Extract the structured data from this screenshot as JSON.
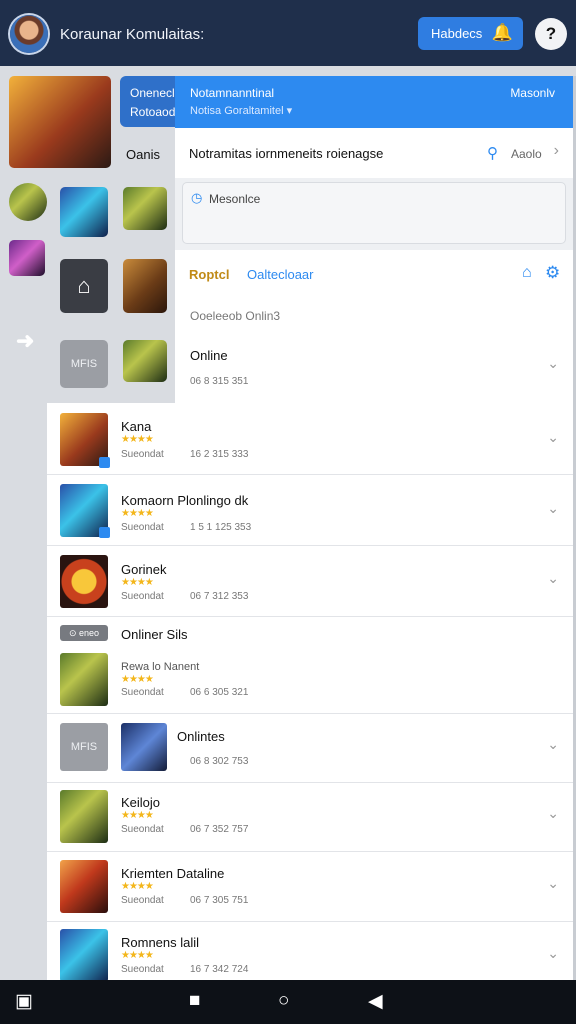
{
  "header": {
    "title": "Koraunar Komulaitas:",
    "action_button": "Habdecs",
    "help_glyph": "?"
  },
  "background": {
    "blue_chip_line1": "Onenecl",
    "blue_chip_line2": "Rotoaod",
    "side_label": "Oanis",
    "gray_tile": "MFIS"
  },
  "dropdown": {
    "header_line1": "Notamnanntinal",
    "header_line2": "Notisa Goraltamitel ▾",
    "header_right": "Masonlv",
    "search_text": "Notramitas iornmeneits roienagse",
    "search_label": "Aaolo",
    "message_label": "Mesonlce",
    "tab_active": "Roptcl",
    "tab_other": "Oaltecloaar",
    "section_label": "Ooeleeob Onlin3",
    "online_name": "Online",
    "online_id": "06 8 315 351"
  },
  "list": [
    {
      "title": "Kana",
      "meta": "Sueondat",
      "num": "16 2 315 333"
    },
    {
      "title": "Komaorn Plonlingo dk",
      "meta": "Sueondat",
      "num": "1 5 1 125 353"
    },
    {
      "title": "Gorinek",
      "meta": "Sueondat",
      "num": "06 7 312 353"
    },
    {
      "pill": "⊙ eneo",
      "section": "Onliner Sils",
      "title": "Rewa lo Nanent",
      "meta": "Sueondat",
      "num": "06 6 305 321"
    },
    {
      "chip": "MFIS",
      "title": "Onlintes",
      "num": "06 8 302 753"
    },
    {
      "title": "Keilojo",
      "meta": "Sueondat",
      "num": "06 7 352 757"
    },
    {
      "title": "Kriemten Dataline",
      "meta": "Sueondat",
      "num": "06 7 305 751"
    },
    {
      "title": "Romnens lalil",
      "meta": "Sueondat",
      "num": "16 7 342 724"
    }
  ],
  "stars": "★★★★",
  "colors": {
    "accent": "#2d8af0",
    "topbar": "#1f2f4b",
    "star": "#f3b61b"
  }
}
